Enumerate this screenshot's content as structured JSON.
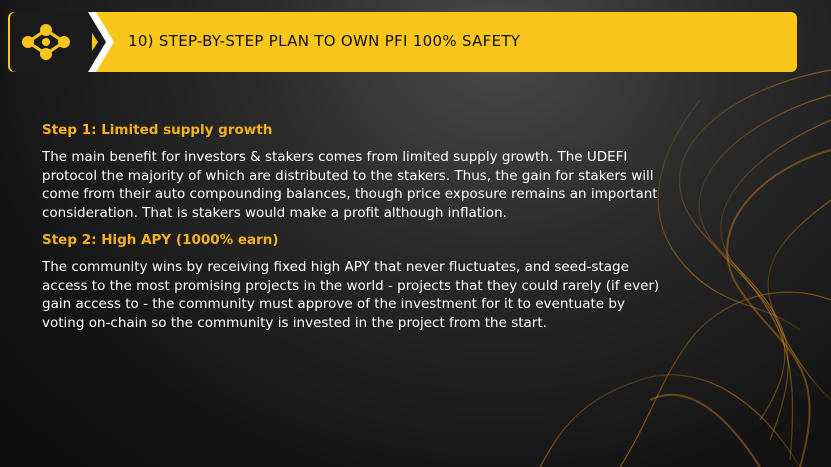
{
  "header": {
    "title": "10) STEP-BY-STEP PLAN TO OWN PFI 100% SAFETY",
    "logo_icon": "molecule-logo-icon"
  },
  "steps": [
    {
      "heading": "Step 1: Limited supply growth",
      "body": "The main benefit for investors & stakers comes from limited supply growth. The UDEFI protocol the majority of which are distributed to the stakers. Thus, the gain for stakers will come from their auto compounding balances, though price exposure remains an important consideration. That is stakers would make a profit although inflation."
    },
    {
      "heading": "Step 2: High APY (1000% earn)",
      "body": "The community wins by receiving fixed high APY that never fluctuates, and seed-stage access to the most promising projects in the world - projects that they could rarely (if ever) gain access to - the community must approve of the investment for it to eventuate by voting on-chain so the community is invested in the project from the start."
    }
  ],
  "colors": {
    "accent": "#f9c61a",
    "heading": "#f6b21a",
    "background": "#1a1a1a"
  }
}
